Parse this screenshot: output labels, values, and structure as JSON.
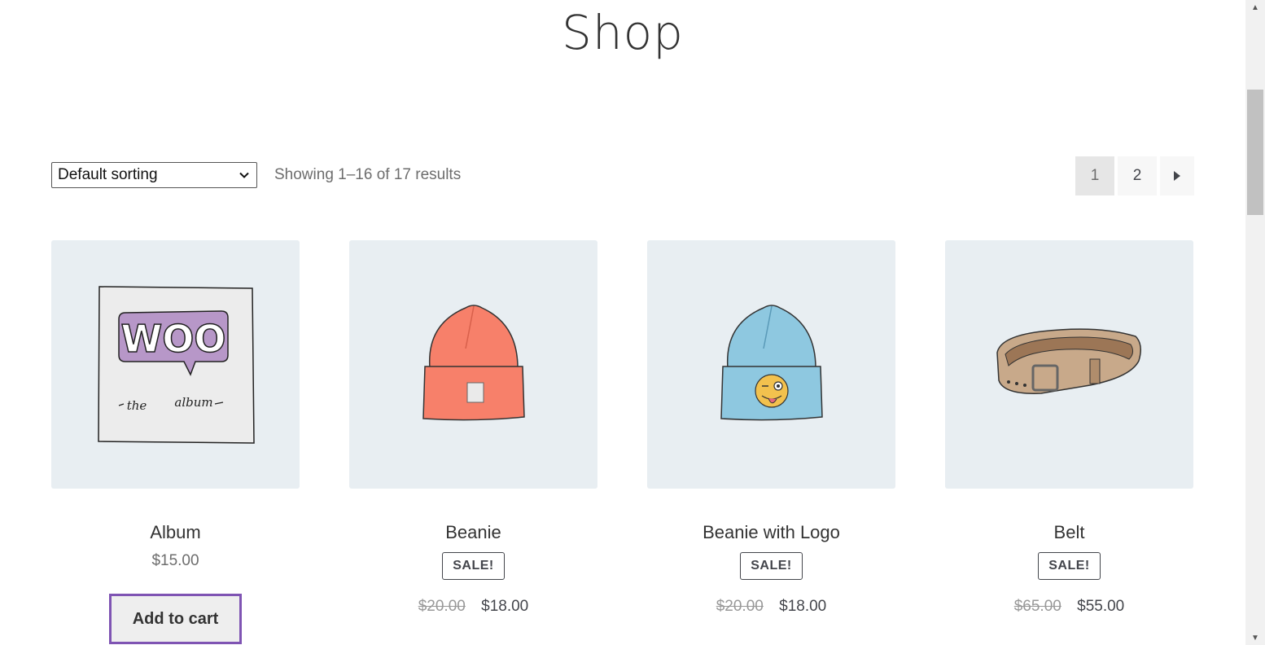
{
  "page": {
    "title": "Shop"
  },
  "toolbar": {
    "sort_selected": "Default sorting",
    "result_count": "Showing 1–16 of 17 results"
  },
  "pagination": {
    "pages": [
      "1",
      "2"
    ],
    "current": "1",
    "next_icon": "caret-right-icon"
  },
  "products": [
    {
      "name": "Album",
      "price": "$15.00",
      "on_sale": false,
      "button": "Add to cart",
      "image": "woo-album-cover"
    },
    {
      "name": "Beanie",
      "on_sale": true,
      "sale_label": "SALE!",
      "regular_price": "$20.00",
      "sale_price": "$18.00",
      "image": "orange-beanie"
    },
    {
      "name": "Beanie with Logo",
      "on_sale": true,
      "sale_label": "SALE!",
      "regular_price": "$20.00",
      "sale_price": "$18.00",
      "image": "blue-beanie-with-emoji"
    },
    {
      "name": "Belt",
      "on_sale": true,
      "sale_label": "SALE!",
      "regular_price": "$65.00",
      "sale_price": "$55.00",
      "image": "leather-belt"
    }
  ],
  "colors": {
    "thumb_bg": "#e8eef2",
    "focus_outline": "#7f54b3",
    "text": "#43454b",
    "muted": "#6d6d6d"
  },
  "album_art": {
    "logo": "WOO",
    "caption_left": "the",
    "caption_right": "album"
  }
}
